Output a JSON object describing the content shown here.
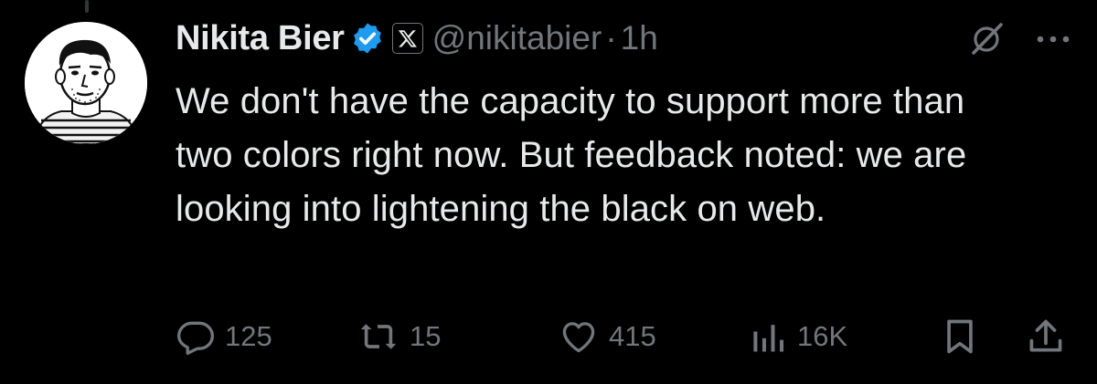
{
  "tweet": {
    "author": {
      "display_name": "Nikita Bier",
      "handle": "@nikitabier",
      "verified_badge_icon": "verified-check-icon",
      "affiliate_badge_icon": "x-logo-icon"
    },
    "separator": "·",
    "timestamp": "1h",
    "body": "We don't have the capacity to support more than two colors right now. But feedback noted: we are looking into lightening the black on web.",
    "header_icons": [
      "grok-icon",
      "more-dots-icon"
    ],
    "actions": {
      "replies": "125",
      "reposts": "15",
      "likes": "415",
      "views": "16K"
    }
  },
  "colors": {
    "background": "#000000",
    "text_primary": "#e7e9ea",
    "text_secondary": "#71767b",
    "verified_blue": "#1d9bf0",
    "thread_line": "#333639"
  }
}
